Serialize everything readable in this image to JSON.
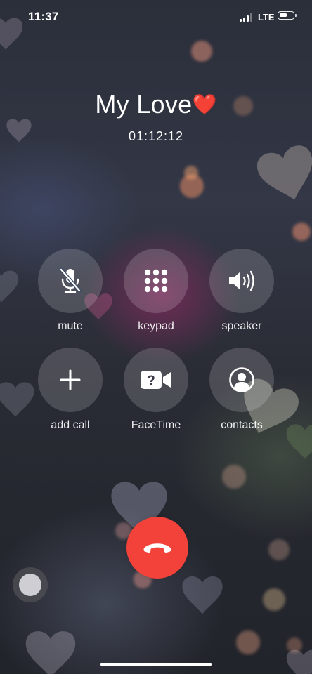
{
  "status_bar": {
    "time": "11:37",
    "network": "LTE",
    "signal_bars": 3,
    "battery_level": 0.6
  },
  "call": {
    "caller_name": "My Love",
    "caller_emoji": "❤️",
    "duration": "01:12:12"
  },
  "controls": [
    {
      "id": "mute",
      "label": "mute",
      "icon": "mic-off-icon"
    },
    {
      "id": "keypad",
      "label": "keypad",
      "icon": "keypad-icon"
    },
    {
      "id": "speaker",
      "label": "speaker",
      "icon": "speaker-icon"
    },
    {
      "id": "add_call",
      "label": "add call",
      "icon": "plus-icon"
    },
    {
      "id": "facetime",
      "label": "FaceTime",
      "icon": "facetime-icon"
    },
    {
      "id": "contacts",
      "label": "contacts",
      "icon": "contact-icon"
    }
  ],
  "end_call": {
    "icon": "end-call-icon",
    "color": "#f2423a"
  },
  "assistive_touch": {
    "icon": "assistive-touch-icon"
  }
}
